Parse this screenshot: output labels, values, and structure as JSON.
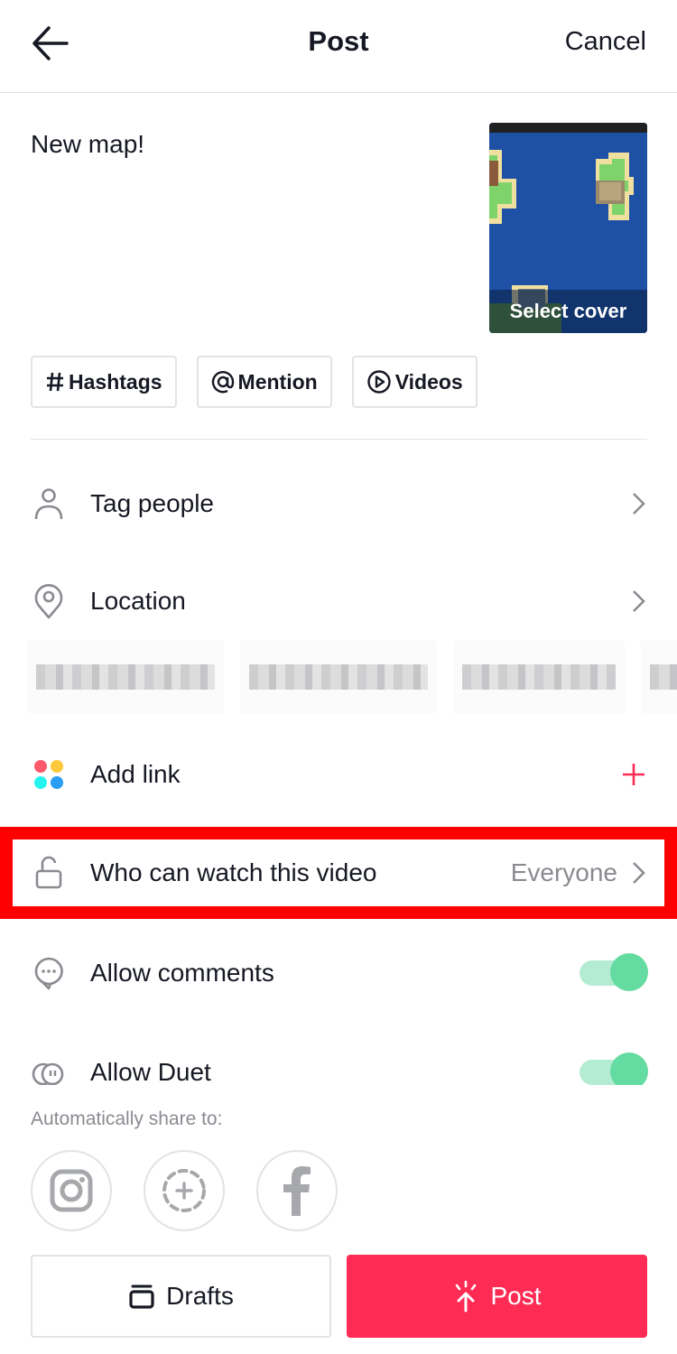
{
  "header": {
    "title": "Post",
    "cancel_label": "Cancel",
    "back_icon": "arrow-left-icon"
  },
  "caption": {
    "text": "New map!"
  },
  "cover": {
    "label": "Select cover"
  },
  "chips": [
    {
      "icon": "hashtag-icon",
      "label": "Hashtags"
    },
    {
      "icon": "at-sign-icon",
      "label": "Mention"
    },
    {
      "icon": "play-circle-icon",
      "label": "Videos"
    }
  ],
  "rows": {
    "tag_people": {
      "icon": "person-icon",
      "label": "Tag people"
    },
    "location": {
      "icon": "location-pin-icon",
      "label": "Location"
    },
    "add_link": {
      "icon": "apps-dots-icon",
      "label": "Add link"
    },
    "privacy": {
      "icon": "unlock-icon",
      "label": "Who can watch this video",
      "value": "Everyone"
    },
    "comments": {
      "icon": "comment-bubble-icon",
      "label": "Allow comments",
      "enabled": true
    },
    "duet": {
      "icon": "duet-icon",
      "label": "Allow Duet",
      "enabled": true
    }
  },
  "location_suggestions_count_visible": 4,
  "share": {
    "label": "Automatically share to:",
    "targets": [
      "Instagram",
      "Story",
      "Facebook"
    ]
  },
  "buttons": {
    "drafts_label": "Drafts",
    "post_label": "Post"
  },
  "colors": {
    "accent": "#fe2c55",
    "toggle_on": "#64dba0",
    "highlight": "#ff0000",
    "muted_text": "#8a8b91"
  }
}
